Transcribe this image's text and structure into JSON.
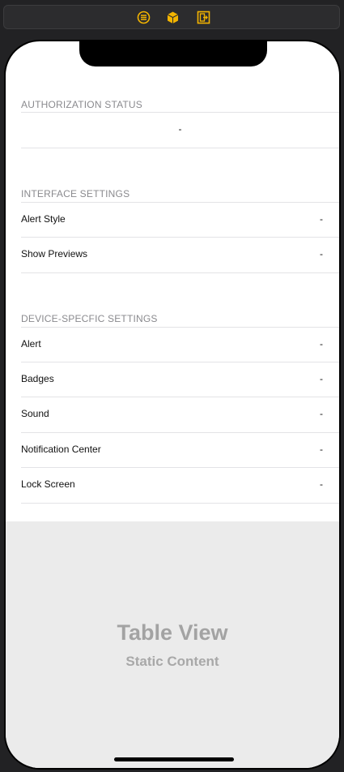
{
  "toolbar": {
    "icons": [
      "list-icon",
      "cube-icon",
      "exit-icon"
    ],
    "accent": "#f3b400"
  },
  "sections": {
    "authorization": {
      "header": "AUTHORIZATION STATUS",
      "value": "-"
    },
    "interface": {
      "header": "INTERFACE SETTINGS",
      "rows": [
        {
          "label": "Alert Style",
          "value": "-"
        },
        {
          "label": "Show Previews",
          "value": "-"
        }
      ]
    },
    "device": {
      "header": "DEVICE-SPECFIC SETTINGS",
      "rows": [
        {
          "label": "Alert",
          "value": "-"
        },
        {
          "label": "Badges",
          "value": "-"
        },
        {
          "label": "Sound",
          "value": "-"
        },
        {
          "label": "Notification Center",
          "value": "-"
        },
        {
          "label": "Lock Screen",
          "value": "-"
        }
      ]
    }
  },
  "placeholder": {
    "title": "Table View",
    "subtitle": "Static Content"
  }
}
